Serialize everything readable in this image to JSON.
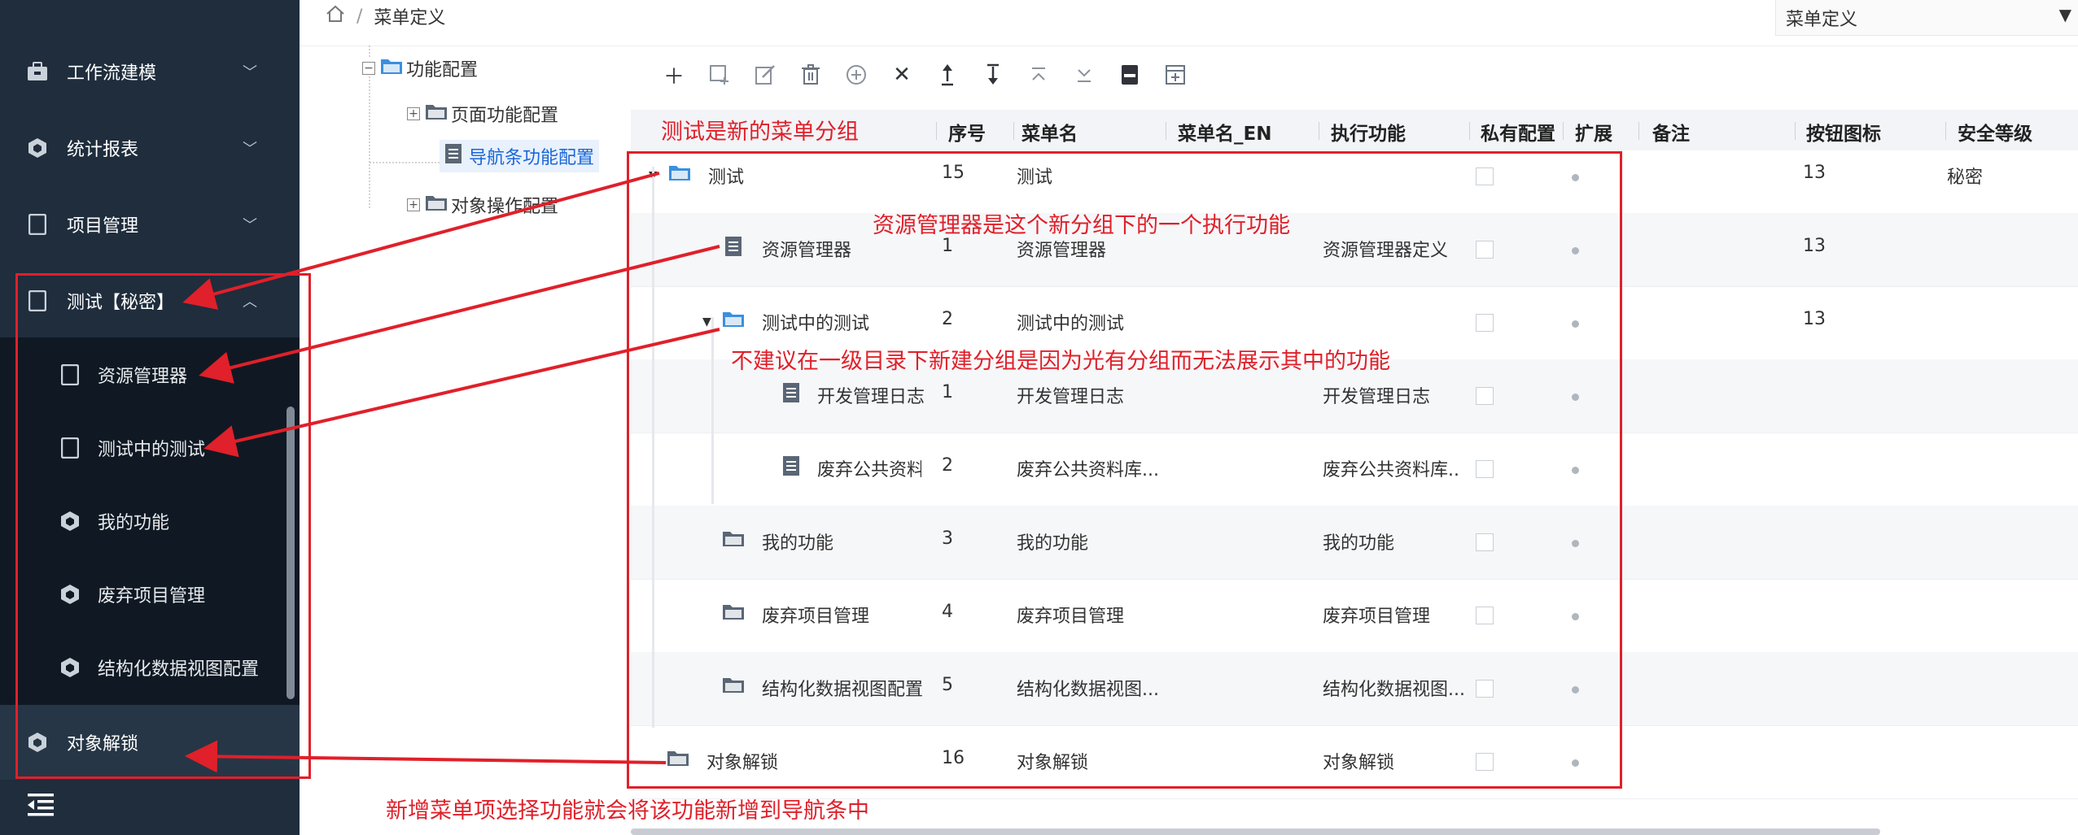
{
  "breadcrumb": {
    "current": "菜单定义"
  },
  "top_select": {
    "value": "菜单定义"
  },
  "sidebar": {
    "items": [
      {
        "label": "工作流建模",
        "icon": "briefcase-icon"
      },
      {
        "label": "统计报表",
        "icon": "cube-icon"
      },
      {
        "label": "项目管理",
        "icon": "document-icon"
      },
      {
        "label": "测试【秘密】",
        "icon": "document-icon"
      }
    ],
    "sub_items": [
      {
        "label": "资源管理器",
        "icon": "document-icon"
      },
      {
        "label": "测试中的测试",
        "icon": "document-icon"
      },
      {
        "label": "我的功能",
        "icon": "cube-icon"
      },
      {
        "label": "废弃项目管理",
        "icon": "cube-icon"
      },
      {
        "label": "结构化数据视图配置",
        "icon": "cube-icon"
      }
    ],
    "bottom_item": {
      "label": "对象解锁",
      "icon": "cube-icon"
    }
  },
  "tree": {
    "nodes": [
      {
        "label": "功能配置"
      },
      {
        "label": "页面功能配置"
      },
      {
        "label": "导航条功能配置"
      },
      {
        "label": "对象操作配置"
      }
    ]
  },
  "toolbar": [
    "add-icon",
    "add-child-icon",
    "edit-icon",
    "delete-icon",
    "circle-plus-icon",
    "close-icon",
    "move-up-icon",
    "move-down-icon",
    "move-top-icon",
    "move-bottom-icon",
    "save-icon",
    "expand-icon"
  ],
  "grid": {
    "headers": [
      "序号",
      "菜单名",
      "菜单名_EN",
      "执行功能",
      "私有配置",
      "扩展",
      "备注",
      "按钮图标",
      "安全等级"
    ],
    "rows": [
      {
        "name": "测试",
        "seq": "15",
        "menu": "测试",
        "func": "",
        "icon": "13",
        "level": "秘密"
      },
      {
        "name": "资源管理器",
        "seq": "1",
        "menu": "资源管理器",
        "func": "资源管理器定义",
        "icon": "13",
        "level": ""
      },
      {
        "name": "测试中的测试",
        "seq": "2",
        "menu": "测试中的测试",
        "func": "",
        "icon": "13",
        "level": ""
      },
      {
        "name": "开发管理日志",
        "seq": "1",
        "menu": "开发管理日志",
        "func": "开发管理日志",
        "icon": "",
        "level": ""
      },
      {
        "name": "废弃公共资料库",
        "seq": "2",
        "menu": "废弃公共资料库...",
        "func": "废弃公共资料库...",
        "icon": "",
        "level": ""
      },
      {
        "name": "我的功能",
        "seq": "3",
        "menu": "我的功能",
        "func": "我的功能",
        "icon": "",
        "level": ""
      },
      {
        "name": "废弃项目管理",
        "seq": "4",
        "menu": "废弃项目管理",
        "func": "废弃项目管理",
        "icon": "",
        "level": ""
      },
      {
        "name": "结构化数据视图配置",
        "seq": "5",
        "menu": "结构化数据视图...",
        "func": "结构化数据视图...",
        "icon": "",
        "level": ""
      },
      {
        "name": "对象解锁",
        "seq": "16",
        "menu": "对象解锁",
        "func": "对象解锁",
        "icon": "",
        "level": ""
      }
    ]
  },
  "annotations": {
    "header_note": "测试是新的菜单分组",
    "note1": "资源管理器是这个新分组下的一个执行功能",
    "note2": "不建议在一级目录下新建分组是因为光有分组而无法展示其中的功能",
    "note3": "新增菜单项选择功能就会将该功能新增到导航条中",
    "color": "#e0202a"
  },
  "colors": {
    "sidebar_bg": "#1f2d3d",
    "submenu_bg": "#101923",
    "accent_blue": "#1a66d8"
  }
}
